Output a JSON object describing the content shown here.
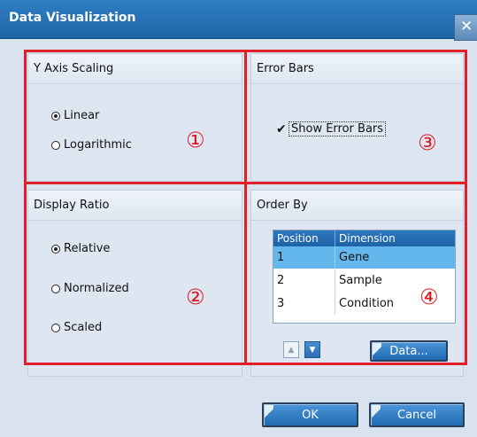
{
  "window": {
    "title": "Data Visualization",
    "close_symbol": "✕"
  },
  "y_axis": {
    "title": "Y Axis Scaling",
    "options": [
      {
        "label": "Linear",
        "checked": true
      },
      {
        "label": "Logarithmic",
        "checked": false
      }
    ],
    "marker": "①"
  },
  "error_bars": {
    "title": "Error Bars",
    "checkbox_label": "Show Error Bars",
    "checked": true,
    "marker": "③"
  },
  "display_ratio": {
    "title": "Display Ratio",
    "options": [
      {
        "label": "Relative",
        "checked": true
      },
      {
        "label": "Normalized",
        "checked": false
      },
      {
        "label": "Scaled",
        "checked": false
      }
    ],
    "marker": "②"
  },
  "order_by": {
    "title": "Order By",
    "columns": [
      "Position",
      "Dimension"
    ],
    "rows": [
      {
        "position": "1",
        "dimension": "Gene",
        "selected": true
      },
      {
        "position": "2",
        "dimension": "Sample",
        "selected": false
      },
      {
        "position": "3",
        "dimension": "Condition",
        "selected": false
      }
    ],
    "up_icon": "chevron-up-icon",
    "down_icon": "chevron-down-icon",
    "data_button": "Data...",
    "marker": "④"
  },
  "footer": {
    "ok_label": "OK",
    "cancel_label": "Cancel"
  },
  "colors": {
    "title_bar": "#1d64a5",
    "highlight_box": "#e01f26",
    "selected_row": "#63b7ec",
    "button": "#216bb2"
  }
}
